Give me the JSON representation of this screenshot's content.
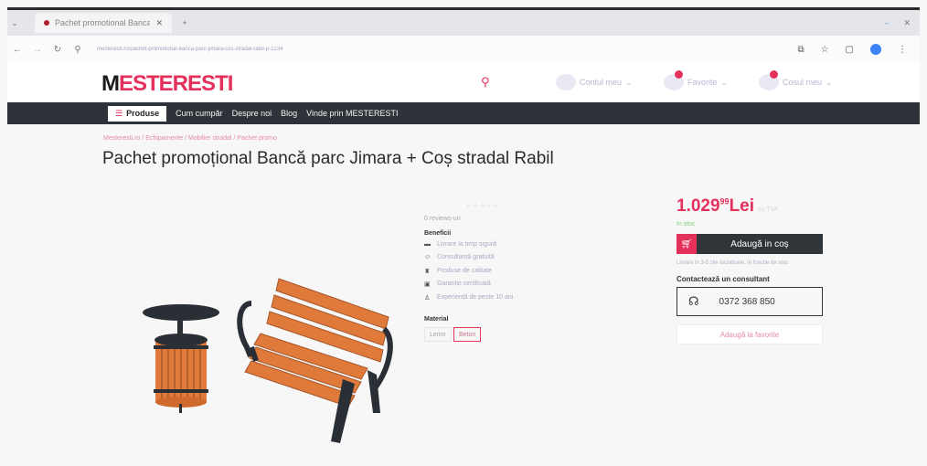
{
  "browser": {
    "tab_title": "Pachet promotional Banca pa...",
    "url": "mesteresti.ro/pachet-promotional-banca-parc-jimara-cos-stradal-rabil-p-1234",
    "icons": [
      "back-icon",
      "forward-icon",
      "reload-icon",
      "site-info-icon",
      "extensions-icon",
      "bookmark-star-icon",
      "sidebar-icon",
      "profile-icon",
      "menu-icon"
    ]
  },
  "header": {
    "logo_first": "M",
    "logo_rest": "ESTERESTI",
    "account_label": "Contul meu",
    "favorites_label": "Favorite",
    "cart_label": "Cosul meu"
  },
  "nav": {
    "products": "Produse",
    "links": [
      "Cum cumpăr",
      "Despre noi",
      "Blog",
      "Vinde prin MESTERESTI"
    ]
  },
  "breadcrumb": "Mesteresti.ro / Echipamente / Mobilier stradal / Pachet promo",
  "product": {
    "title": "Pachet promoțional Bancă parc Jimara + Coș stradal Rabil",
    "reviews": "0 reviews-uri",
    "benefits_title": "Beneficii",
    "benefits": [
      "Livrare la timp sigură",
      "Consultanță gratuită",
      "Produse de calitate",
      "Garanție certificată",
      "Experiență de peste 10 ani"
    ],
    "material_title": "Material",
    "material_options": [
      "Lemn",
      "Beton"
    ],
    "material_selected": "Beton"
  },
  "buybox": {
    "price_int": "1.029",
    "price_dec": "99",
    "currency": "Lei",
    "vat_note": "cu TVA",
    "stock": "In stoc",
    "add_to_cart": "Adaugă in coș",
    "shipping_note": "Livrare in 3-5 zile lucratoare, in functie de stoc",
    "consultant_title": "Contactează un consultant",
    "phone": "0372 368 850",
    "add_to_favorites": "Adaugă la favorite"
  },
  "colors": {
    "brand": "#e4315c",
    "nav_bg": "#2d3338",
    "wood": "#e07a3a",
    "metal": "#2a2f35"
  }
}
